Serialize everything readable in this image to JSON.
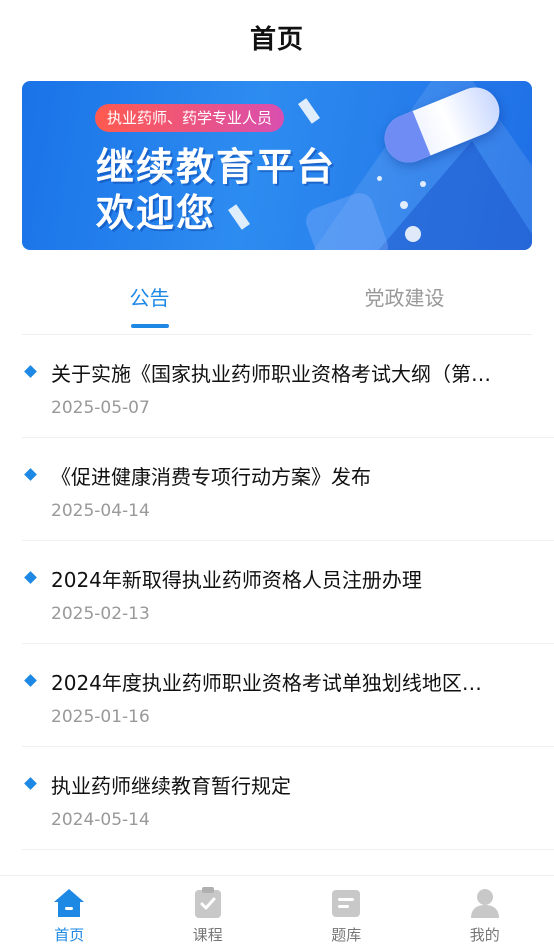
{
  "header": {
    "title": "首页"
  },
  "banner": {
    "tag": "执业药师、药学专业人员",
    "line1": "继续教育平台",
    "line2": "欢迎您"
  },
  "tabs": [
    {
      "label": "公告",
      "active": true
    },
    {
      "label": "党政建设",
      "active": false
    }
  ],
  "announcements": [
    {
      "title": "关于实施《国家执业药师职业资格考试大纲（第…",
      "date": "2025-05-07"
    },
    {
      "title": "《促进健康消费专项行动方案》发布",
      "date": "2025-04-14"
    },
    {
      "title": "2024年新取得执业药师资格人员注册办理",
      "date": "2025-02-13"
    },
    {
      "title": "2024年度执业药师职业资格考试单独划线地区…",
      "date": "2025-01-16"
    },
    {
      "title": "执业药师继续教育暂行规定",
      "date": "2024-05-14"
    }
  ],
  "bottom_nav": [
    {
      "label": "首页",
      "icon": "home-icon",
      "active": true
    },
    {
      "label": "课程",
      "icon": "course-icon",
      "active": false
    },
    {
      "label": "题库",
      "icon": "question-bank-icon",
      "active": false
    },
    {
      "label": "我的",
      "icon": "profile-icon",
      "active": false
    }
  ],
  "colors": {
    "accent": "#1e88e5",
    "inactive": "#999999"
  }
}
